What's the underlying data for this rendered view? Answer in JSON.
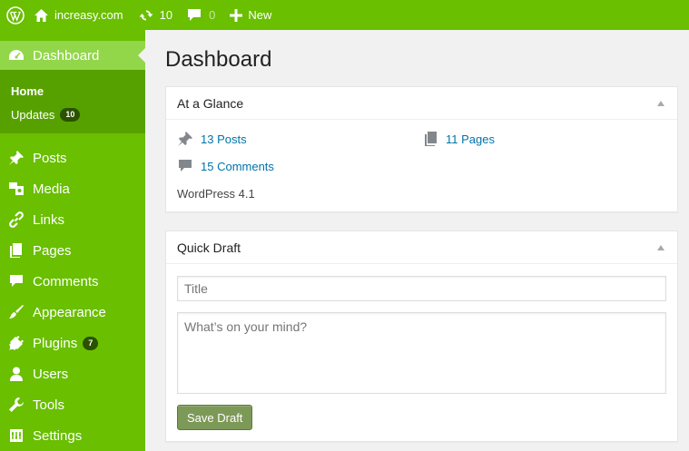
{
  "adminbar": {
    "site_name": "increasy.com",
    "updates_count": "10",
    "comments_count": "0",
    "new_label": "New"
  },
  "sidebar": {
    "current": {
      "label": "Dashboard",
      "icon": "dashboard-icon"
    },
    "submenu": [
      {
        "label": "Home"
      },
      {
        "label": "Updates",
        "badge": "10"
      }
    ],
    "items": [
      {
        "label": "Posts",
        "icon": "pin-icon"
      },
      {
        "label": "Media",
        "icon": "media-icon"
      },
      {
        "label": "Links",
        "icon": "link-icon"
      },
      {
        "label": "Pages",
        "icon": "pages-icon"
      },
      {
        "label": "Comments",
        "icon": "comment-icon"
      },
      {
        "label": "Appearance",
        "icon": "brush-icon"
      },
      {
        "label": "Plugins",
        "icon": "plugin-icon",
        "badge": "7"
      },
      {
        "label": "Users",
        "icon": "user-icon"
      },
      {
        "label": "Tools",
        "icon": "wrench-icon"
      },
      {
        "label": "Settings",
        "icon": "settings-icon"
      }
    ]
  },
  "main": {
    "title": "Dashboard",
    "at_a_glance": {
      "heading": "At a Glance",
      "posts": "13 Posts",
      "pages": "11 Pages",
      "comments": "15 Comments",
      "version": "WordPress 4.1"
    },
    "quick_draft": {
      "heading": "Quick Draft",
      "title_placeholder": "Title",
      "content_placeholder": "What’s on your mind?",
      "save_label": "Save Draft"
    }
  },
  "colors": {
    "accent": "#69bf00",
    "current_menu": "#92d64a",
    "submenu_bg": "#56a100",
    "link": "#0073aa",
    "save_button": "#7d9957"
  }
}
